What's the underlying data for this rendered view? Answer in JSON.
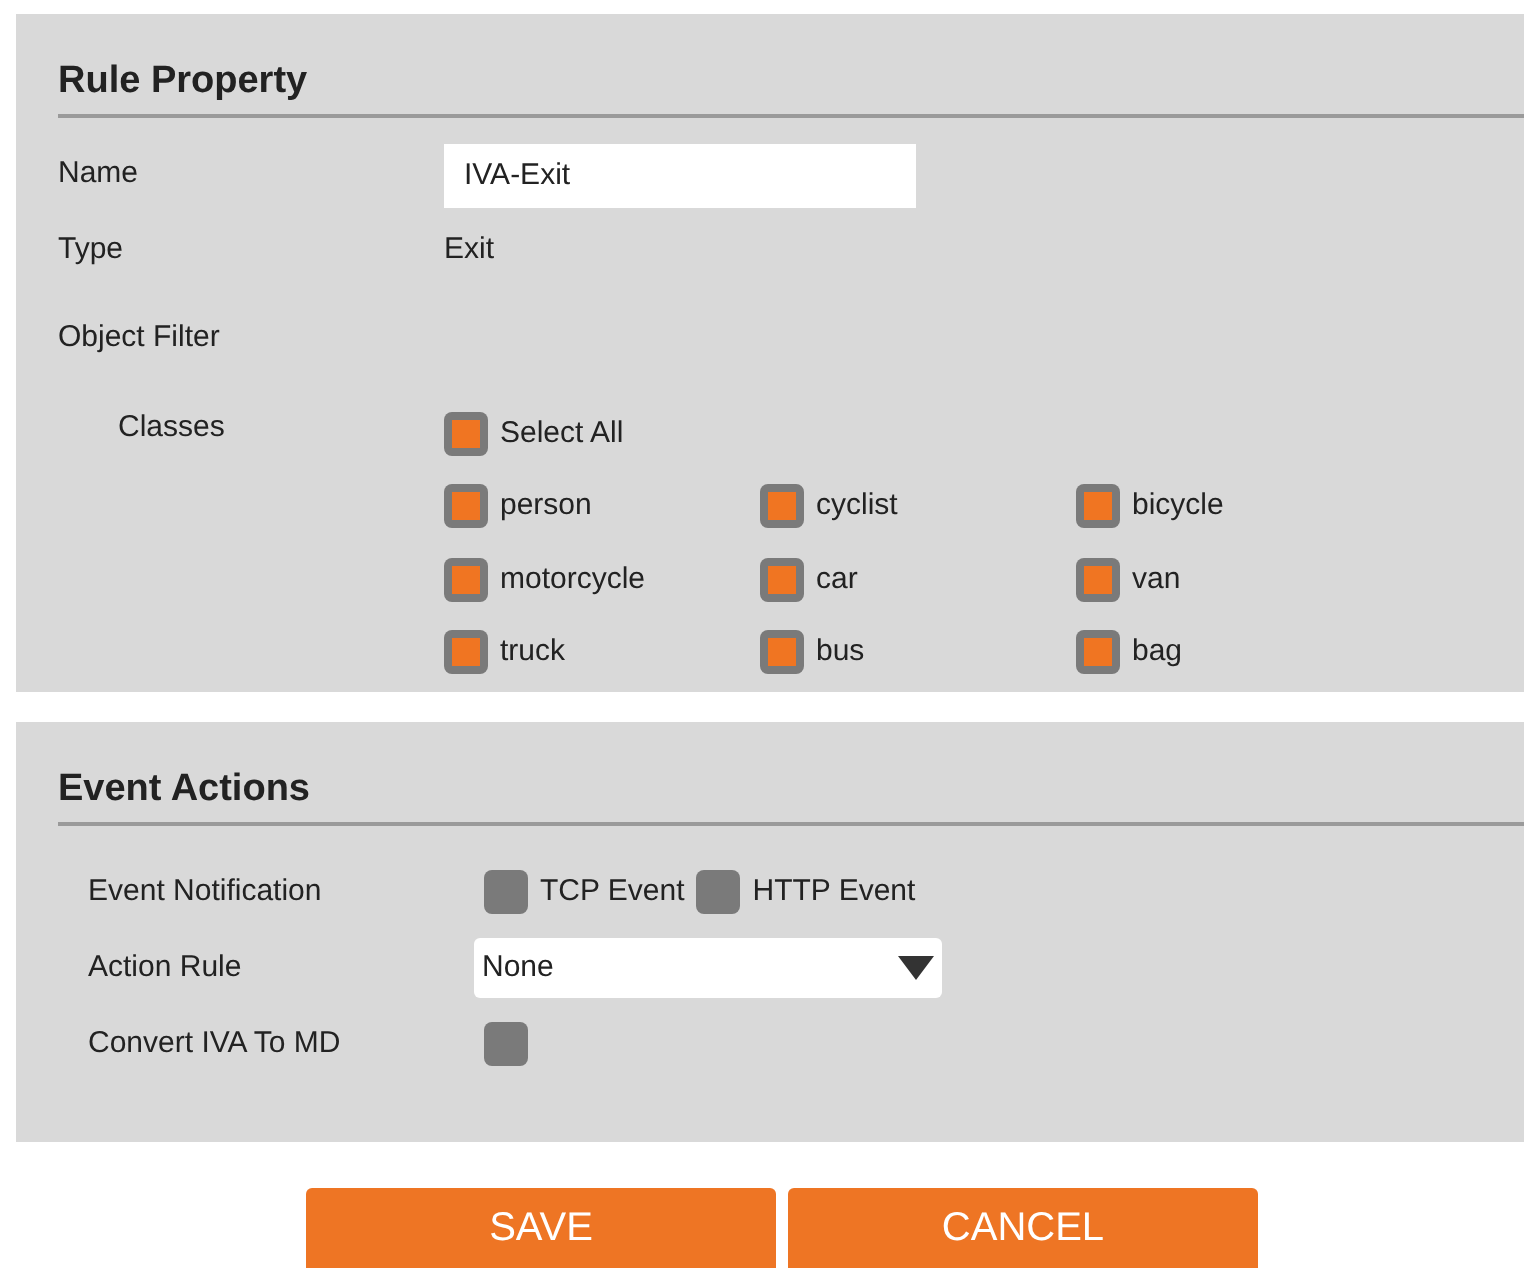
{
  "rule_property": {
    "title": "Rule Property",
    "name_label": "Name",
    "name_value": "IVA-Exit",
    "type_label": "Type",
    "type_value": "Exit",
    "object_filter_label": "Object Filter",
    "classes_label": "Classes",
    "select_all": {
      "label": "Select All",
      "checked": true
    },
    "classes": [
      {
        "label": "person",
        "checked": true
      },
      {
        "label": "cyclist",
        "checked": true
      },
      {
        "label": "bicycle",
        "checked": true
      },
      {
        "label": "motorcycle",
        "checked": true
      },
      {
        "label": "car",
        "checked": true
      },
      {
        "label": "van",
        "checked": true
      },
      {
        "label": "truck",
        "checked": true
      },
      {
        "label": "bus",
        "checked": true
      },
      {
        "label": "bag",
        "checked": true
      }
    ]
  },
  "event_actions": {
    "title": "Event Actions",
    "notification_label": "Event Notification",
    "notifications": [
      {
        "label": "TCP Event",
        "checked": false
      },
      {
        "label": "HTTP Event",
        "checked": false
      }
    ],
    "action_rule_label": "Action Rule",
    "action_rule_value": "None",
    "convert_label": "Convert IVA To MD",
    "convert_checked": false
  },
  "buttons": [
    "SAVE",
    "CANCEL"
  ]
}
